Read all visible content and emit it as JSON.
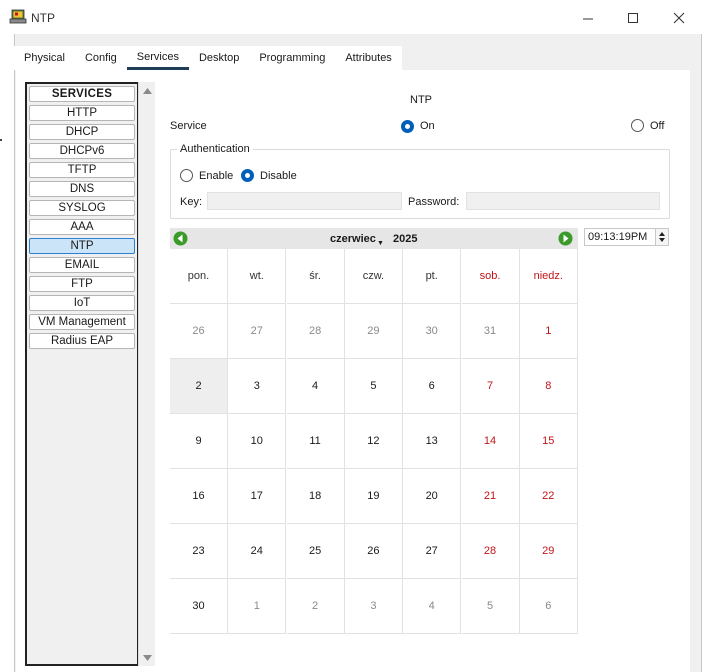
{
  "window": {
    "title": "NTP"
  },
  "tabs": [
    "Physical",
    "Config",
    "Services",
    "Desktop",
    "Programming",
    "Attributes"
  ],
  "active_tab": "Services",
  "services": {
    "header": "SERVICES",
    "items": [
      "HTTP",
      "DHCP",
      "DHCPv6",
      "TFTP",
      "DNS",
      "SYSLOG",
      "AAA",
      "NTP",
      "EMAIL",
      "FTP",
      "IoT",
      "VM Management",
      "Radius EAP"
    ],
    "selected": "NTP"
  },
  "ntp": {
    "title": "NTP",
    "service_label": "Service",
    "on_label": "On",
    "off_label": "Off",
    "service_state": "On",
    "auth": {
      "legend": "Authentication",
      "enable_label": "Enable",
      "disable_label": "Disable",
      "state": "Disable",
      "key_label": "Key:",
      "key_value": "",
      "password_label": "Password:",
      "password_value": ""
    }
  },
  "calendar": {
    "month": "czerwiec",
    "year": "2025",
    "weekdays": [
      "pon.",
      "wt.",
      "śr.",
      "czw.",
      "pt.",
      "sob.",
      "niedz."
    ],
    "weeks": [
      [
        "26",
        "27",
        "28",
        "29",
        "30",
        "31",
        "1"
      ],
      [
        "2",
        "3",
        "4",
        "5",
        "6",
        "7",
        "8"
      ],
      [
        "9",
        "10",
        "11",
        "12",
        "13",
        "14",
        "15"
      ],
      [
        "16",
        "17",
        "18",
        "19",
        "20",
        "21",
        "22"
      ],
      [
        "23",
        "24",
        "25",
        "26",
        "27",
        "28",
        "29"
      ],
      [
        "30",
        "1",
        "2",
        "3",
        "4",
        "5",
        "6"
      ]
    ],
    "selected_day": "2",
    "time": "09:13:19PM"
  },
  "colors": {
    "accent": "#005fb8",
    "selected_item_bg": "#cce4f7",
    "weekend": "#c0141a",
    "nav_arrow": "#3a9a2a",
    "tab_underline": "#1d3d58"
  }
}
